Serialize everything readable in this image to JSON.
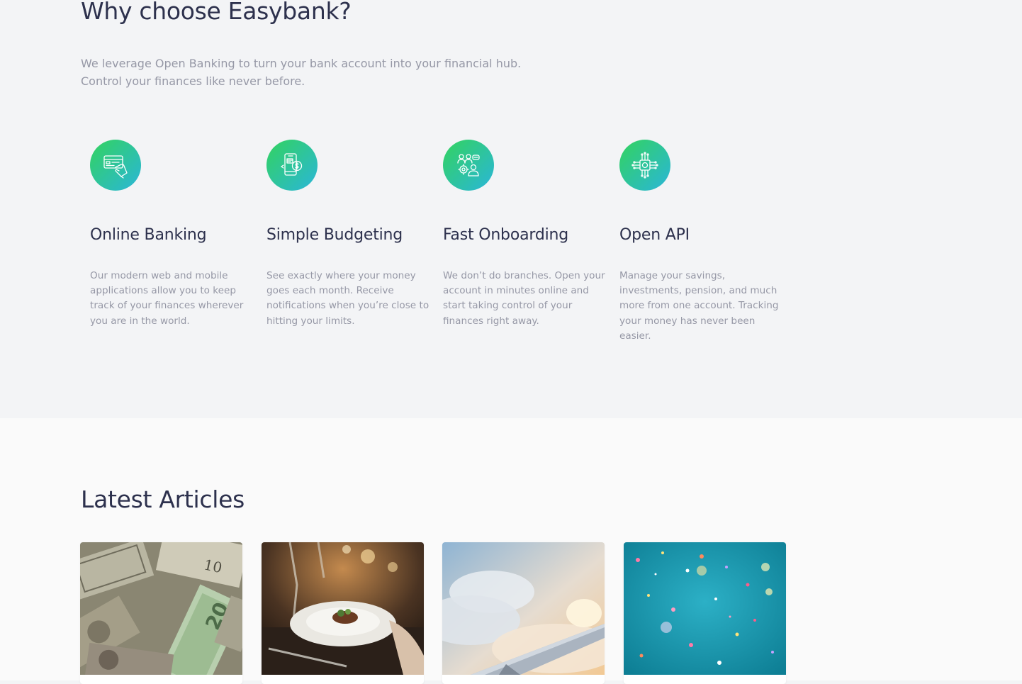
{
  "why": {
    "title": "Why choose Easybank?",
    "intro_lines": [
      "We leverage Open Banking to turn your bank account into your financial hub.",
      "Control your finances like never before."
    ],
    "features": [
      {
        "icon": "online-banking-icon",
        "title": "Online Banking",
        "desc_lines": [
          "Our modern web and mobile",
          "applications allow you to keep",
          "track of your finances wherever",
          "you are in the world."
        ]
      },
      {
        "icon": "budgeting-icon",
        "title": "Simple Budgeting",
        "desc_lines": [
          "See exactly where your money",
          "goes each month. Receive",
          "notifications when you’re close to",
          "hitting your limits."
        ]
      },
      {
        "icon": "onboarding-icon",
        "title": "Fast Onboarding",
        "desc_lines": [
          "We don’t do branches. Open your",
          "account in minutes online and",
          "start taking control of your",
          "finances right away."
        ]
      },
      {
        "icon": "api-icon",
        "title": "Open API",
        "desc_lines": [
          "Manage your savings,",
          "investments, pension, and much",
          "more from one account. Tracking",
          "your money has never been",
          "easier."
        ]
      }
    ],
    "colors": {
      "gradient_start": "#33d35e",
      "gradient_end": "#2ab6d9",
      "heading": "#2d314d",
      "body": "#9698a6"
    }
  },
  "articles": {
    "title": "Latest Articles",
    "cards": [
      {
        "image": "currency-image"
      },
      {
        "image": "restaurant-image"
      },
      {
        "image": "plane-image"
      },
      {
        "image": "confetti-image"
      }
    ]
  }
}
